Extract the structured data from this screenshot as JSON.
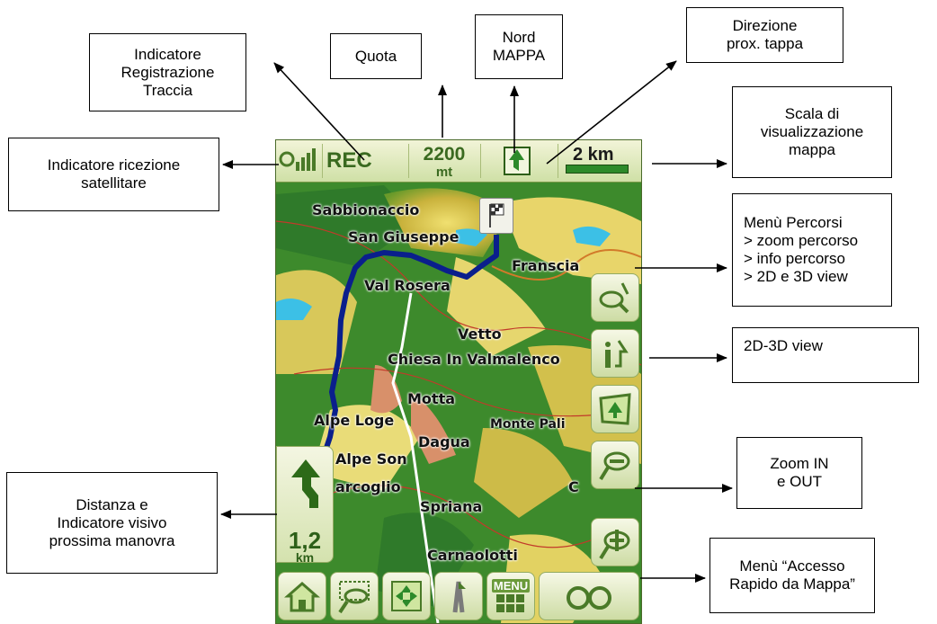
{
  "callouts": {
    "registrazione": "Indicatore\nRegistrazione\nTraccia",
    "quota": "Quota",
    "nord": "Nord\nMAPPA",
    "direzione": "Direzione\nprox. tappa",
    "scala": "Scala di\nvisualizzazione\nmappa",
    "satellitare": "Indicatore ricezione\nsatellitare",
    "percorsi": "Menù Percorsi\n> zoom percorso\n> info percorso\n> 2D e 3D view",
    "view": "2D-3D view",
    "zoom": "Zoom IN\ne OUT",
    "distanza": "Distanza e\nIndicatore visivo\nprossima manovra",
    "accesso": "Menù “Accesso\nRapido da Mappa”"
  },
  "device": {
    "rec_label": "REC",
    "altitude_value": "2200",
    "altitude_unit": "mt",
    "scale_label": "2 km",
    "distance_value": "1,2",
    "distance_unit": "km",
    "menu_label": "MENU",
    "places": [
      "Sabbionaccio",
      "San Giuseppe",
      "Franscia",
      "Val Rosera",
      "Vetto",
      "Chiesa In Valmalenco",
      "Motta",
      "Alpe Loge",
      "Monte Pali",
      "Dagua",
      "Alpe Son",
      "arcoglio",
      "Spriana",
      "C",
      "Carnaolotti"
    ]
  },
  "colors": {
    "route": "#0a1f8c",
    "map_green": "#3f8a2e",
    "toolbar": "#d8e6b4",
    "button_icon": "#4a7a28"
  },
  "icons": {
    "satellite": "satellite-icon",
    "north": "north-arrow-icon",
    "route_menu": "route-menu-icon",
    "info": "info-icon",
    "view3d": "view-3d-icon",
    "zoom_out": "zoom-out-icon",
    "zoom_in": "zoom-in-icon",
    "home": "home-icon",
    "zoom_area": "zoom-area-icon",
    "center": "center-map-icon",
    "road": "road-icon",
    "quick_access": "quick-access-glasses-icon",
    "turn": "turn-left-arrow-icon",
    "flag": "checkered-flag-icon"
  }
}
